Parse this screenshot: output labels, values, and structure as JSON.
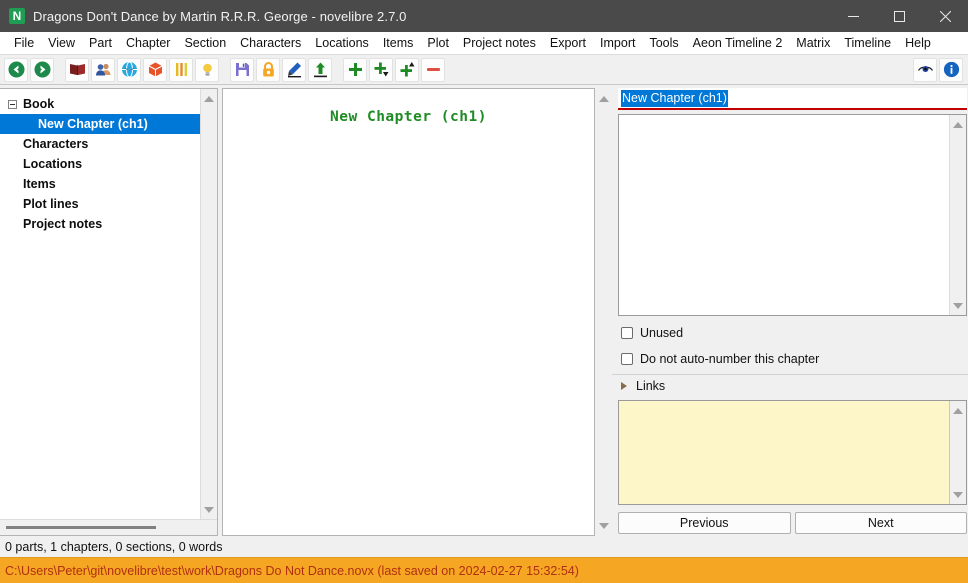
{
  "window": {
    "title": "Dragons Don't Dance by Martin R.R.R. George - novelibre 2.7.0",
    "app_icon_letter": "N",
    "controls": {
      "minimize": "minimize-button",
      "maximize": "maximize-button",
      "close": "close-button"
    }
  },
  "menubar": {
    "items": [
      {
        "label": "File"
      },
      {
        "label": "View"
      },
      {
        "label": "Part"
      },
      {
        "label": "Chapter"
      },
      {
        "label": "Section"
      },
      {
        "label": "Characters"
      },
      {
        "label": "Locations"
      },
      {
        "label": "Items"
      },
      {
        "label": "Plot"
      },
      {
        "label": "Project notes"
      },
      {
        "label": "Export"
      },
      {
        "label": "Import"
      },
      {
        "label": "Tools"
      },
      {
        "label": "Aeon Timeline 2"
      },
      {
        "label": "Matrix"
      },
      {
        "label": "Timeline"
      },
      {
        "label": "Help"
      }
    ]
  },
  "toolbar": {
    "groups": [
      {
        "buttons": [
          {
            "icon": "back-arrow-icon",
            "color": "#1d8a4b"
          },
          {
            "icon": "forward-arrow-icon",
            "color": "#1d8a4b"
          }
        ]
      },
      {
        "buttons": [
          {
            "icon": "book-icon",
            "color": "#7a1f1f"
          },
          {
            "icon": "characters-icon",
            "color": "#3a63a8"
          },
          {
            "icon": "globe-icon",
            "color": "#29a8e0"
          },
          {
            "icon": "box-icon",
            "color": "#e8542a"
          },
          {
            "icon": "plotlines-icon",
            "color": "#e8b820"
          },
          {
            "icon": "lightbulb-icon",
            "color": "#f2cc40"
          }
        ]
      },
      {
        "buttons": [
          {
            "icon": "save-icon",
            "color": "#6a5acd"
          },
          {
            "icon": "lock-icon",
            "color": "#f5a623"
          },
          {
            "icon": "pencil-icon",
            "color": "#1e5fbf"
          },
          {
            "icon": "upload-icon",
            "color": "#1f8b24"
          }
        ]
      },
      {
        "buttons": [
          {
            "icon": "add-icon",
            "color": "#1f8b24"
          },
          {
            "icon": "add-child-icon",
            "color": "#1f8b24"
          },
          {
            "icon": "add-parent-icon",
            "color": "#1f8b24"
          },
          {
            "icon": "remove-icon",
            "color": "#e05040"
          }
        ]
      }
    ],
    "right_buttons": [
      {
        "icon": "eye-icon",
        "color": "#1f3f9f"
      },
      {
        "icon": "info-icon",
        "color": "#1565c0"
      }
    ]
  },
  "sidebar": {
    "tree": [
      {
        "label": "Book",
        "level": 0,
        "selected": false,
        "expandable": true
      },
      {
        "label": "New Chapter (ch1)",
        "level": 1,
        "selected": true,
        "expandable": false
      },
      {
        "label": "Characters",
        "level": 0,
        "selected": false,
        "expandable": false
      },
      {
        "label": "Locations",
        "level": 0,
        "selected": false,
        "expandable": false
      },
      {
        "label": "Items",
        "level": 0,
        "selected": false,
        "expandable": false
      },
      {
        "label": "Plot lines",
        "level": 0,
        "selected": false,
        "expandable": false
      },
      {
        "label": "Project notes",
        "level": 0,
        "selected": false,
        "expandable": false
      }
    ]
  },
  "center": {
    "chapter_heading": "New Chapter (ch1)",
    "heading_color": "#1f8b24"
  },
  "properties": {
    "title_value": "New Chapter (ch1)",
    "description_value": "",
    "checkboxes": [
      {
        "label": "Unused",
        "checked": false
      },
      {
        "label": "Do not auto-number this chapter",
        "checked": false
      }
    ],
    "links_label": "Links",
    "links_expanded": false,
    "notes_value": "",
    "buttons": {
      "previous": "Previous",
      "next": "Next"
    }
  },
  "status": {
    "counts": "0 parts, 1 chapters, 0 sections, 0 words",
    "path": "C:\\Users\\Peter\\git\\novelibre\\test\\work\\Dragons Do Not Dance.novx (last saved on 2024-02-27 15:32:54)",
    "path_bar_color": "#f5a623",
    "path_text_color": "#b03010"
  }
}
